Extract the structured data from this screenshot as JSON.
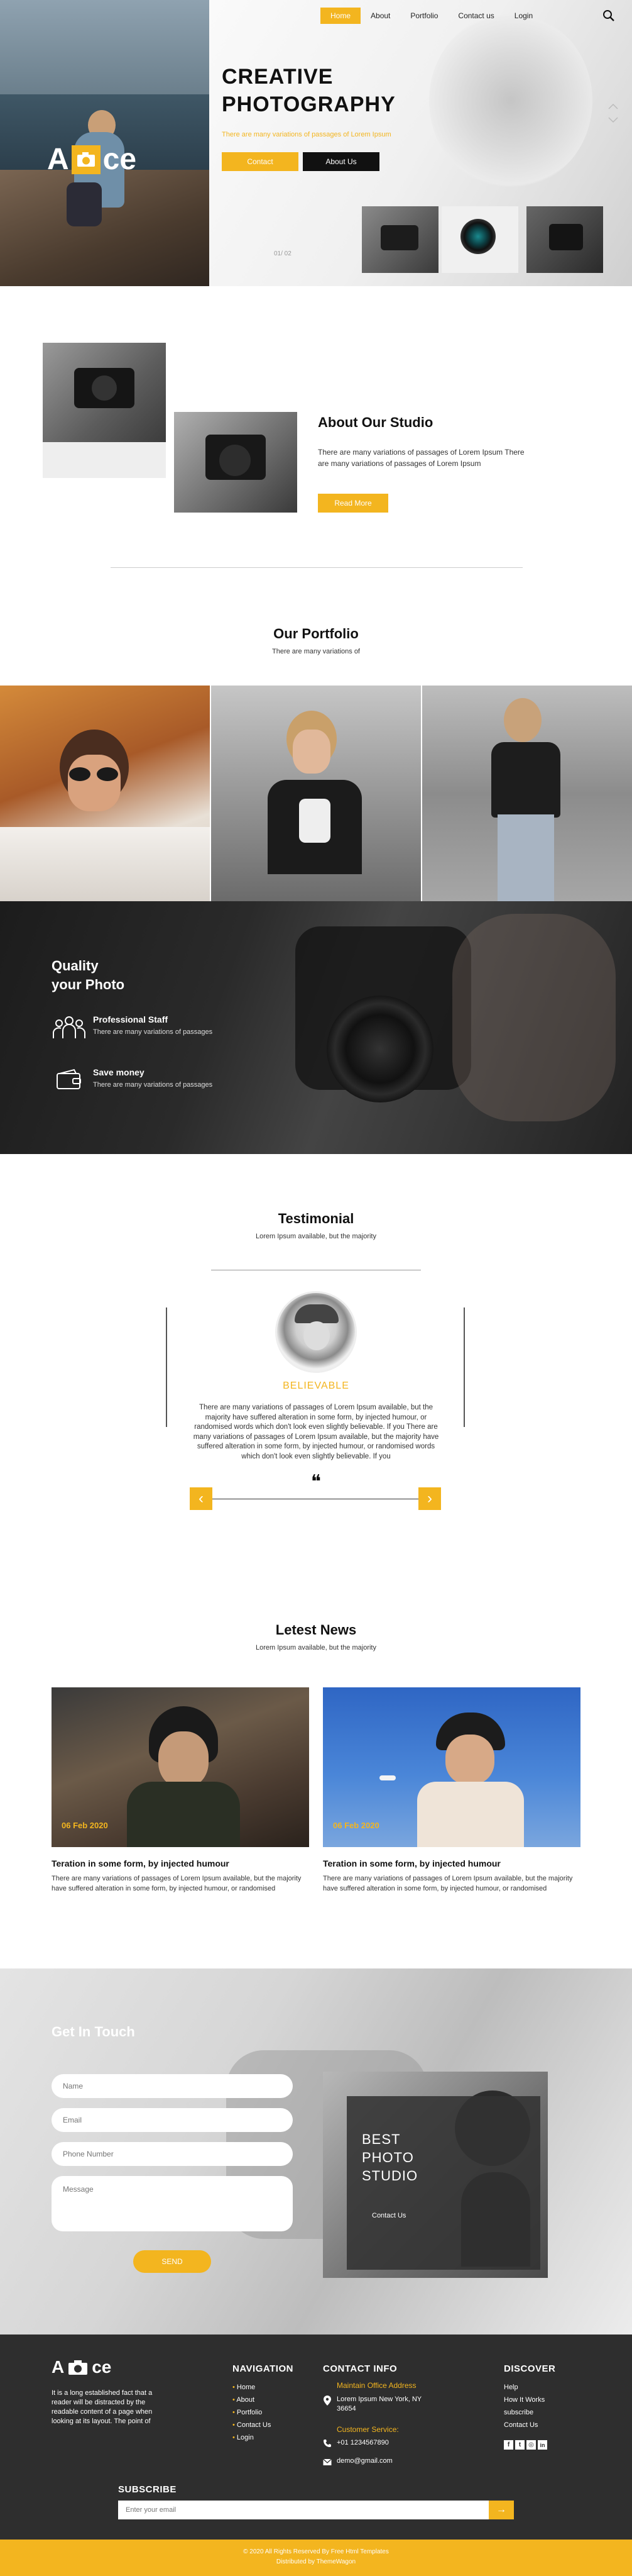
{
  "nav": {
    "items": [
      {
        "label": "Home"
      },
      {
        "label": "About"
      },
      {
        "label": "Portfolio"
      },
      {
        "label": "Contact us"
      },
      {
        "label": "Login"
      }
    ]
  },
  "hero": {
    "logo_left": "A",
    "logo_right": "ce",
    "title_line1": "CREATIVE",
    "title_line2": "PHOTOGRAPHY",
    "subtitle": "There are many variations of passages of Lorem Ipsum",
    "contact_button": "Contact",
    "about_button": "About Us",
    "pager": "01/ 02"
  },
  "about": {
    "title": "About Our Studio",
    "text": "There are many variations of passages of Lorem Ipsum There are many variations of passages of Lorem Ipsum",
    "button": "Read More"
  },
  "portfolio": {
    "title": "Our Portfolio",
    "subtitle": "There are many variations of"
  },
  "quality": {
    "title_line1": "Quality",
    "title_line2": "your Photo",
    "features": [
      {
        "title": "Professional Staff",
        "text": "There are many variations of passages",
        "icon": "team-icon"
      },
      {
        "title": "Save money",
        "text": "There are many variations of passages",
        "icon": "wallet-icon"
      }
    ]
  },
  "testimonial": {
    "title": "Testimonial",
    "subtitle": "Lorem Ipsum available, but the majority",
    "name": "BELIEVABLE",
    "text": "There are many variations of passages of Lorem Ipsum available, but the majority have suffered alteration in some form, by injected humour, or randomised words which don't look even slightly believable. If you There are many variations of passages of Lorem Ipsum available, but the majority have suffered alteration in some form, by injected humour, or randomised words which don't look even slightly believable. If you",
    "quote": "❝",
    "prev": "‹",
    "next": "›"
  },
  "news": {
    "title": "Letest News",
    "subtitle": "Lorem Ipsum available, but the majority",
    "items": [
      {
        "date": "06 Feb 2020",
        "title": "Teration in some form, by injected humour",
        "text": "There are many variations of passages of Lorem Ipsum available, but the majority have suffered alteration in some form, by injected humour, or randomised"
      },
      {
        "date": "06 Feb 2020",
        "title": "Teration in some form, by injected humour",
        "text": "There are many variations of passages of Lorem Ipsum available, but the majority have suffered alteration in some form, by injected humour, or randomised"
      }
    ]
  },
  "contact": {
    "title": "Get In Touch",
    "name_ph": "Name",
    "email_ph": "Email",
    "phone_ph": "Phone Number",
    "message_ph": "Message",
    "send": "SEND",
    "studio_line1": "BEST",
    "studio_line2": "PHOTO",
    "studio_line3": "STUDIO",
    "studio_button": "Contact Us"
  },
  "footer": {
    "logo_left": "A",
    "logo_right": "ce",
    "about_text": "It is a long established fact that a reader will be distracted by the readable content of a page when looking at its layout. The point of",
    "nav_title": "NAVIGATION",
    "nav_items": [
      "Home",
      "About",
      "Portfolio",
      "Contact Us",
      "Login"
    ],
    "contact_title": "CONTACT INFO",
    "office_label": "Maintain Office Address",
    "address": "Lorem Ipsum New York, NY 36654",
    "service_label": "Customer Service:",
    "phone": "+01 1234567890",
    "email": "demo@gmail.com",
    "discover_title": "DISCOVER",
    "discover_items": [
      "Help",
      "How It Works",
      "subscribe",
      "Contact Us"
    ],
    "subscribe_title": "SUBSCRIBE",
    "subscribe_ph": "Enter your email",
    "copyright_line1": "© 2020 All Rights Reserved By Free Html Templates",
    "copyright_line2": "Distributed by ThemeWagon"
  },
  "colors": {
    "accent": "#f3b51f",
    "dark": "#2e2e2e"
  }
}
